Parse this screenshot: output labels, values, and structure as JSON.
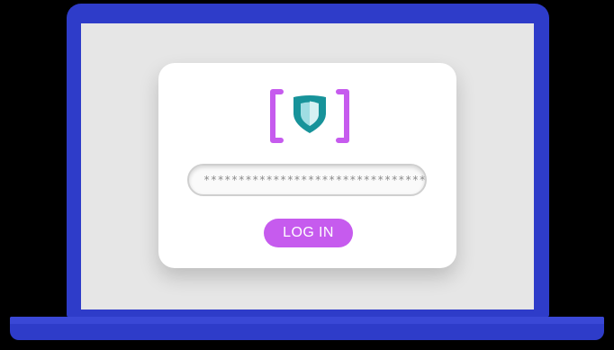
{
  "colors": {
    "laptop_body": "#2e3cc9",
    "screen_background": "#e6e6e6",
    "card_background": "#ffffff",
    "accent_purple": "#c65bee",
    "shield_teal": "#17939a"
  },
  "icons": {
    "logo": "bracketed-shield-icon"
  },
  "login": {
    "password_value": "********************************",
    "button_label": "LOG IN"
  }
}
